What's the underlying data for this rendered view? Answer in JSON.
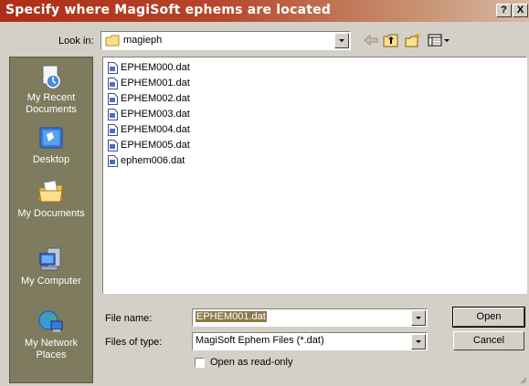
{
  "window": {
    "title": "Specify where MagiSoft ephems are located",
    "help_label": "?",
    "close_label": "X"
  },
  "lookin": {
    "label": "Look in:",
    "value": "magieph"
  },
  "places": [
    {
      "label": "My Recent Documents",
      "icon": "recent-documents-icon"
    },
    {
      "label": "Desktop",
      "icon": "desktop-icon"
    },
    {
      "label": "My Documents",
      "icon": "my-documents-icon"
    },
    {
      "label": "My Computer",
      "icon": "my-computer-icon"
    },
    {
      "label": "My Network Places",
      "icon": "network-places-icon"
    }
  ],
  "files": [
    "EPHEM000.dat",
    "EPHEM001.dat",
    "EPHEM002.dat",
    "EPHEM003.dat",
    "EPHEM004.dat",
    "EPHEM005.dat",
    "ephem006.dat"
  ],
  "filename": {
    "label": "File name:",
    "value": "EPHEM001.dat"
  },
  "filetype": {
    "label": "Files of type:",
    "value": "MagiSoft Ephem Files (*.dat)"
  },
  "readonly": {
    "label": "Open as read-only",
    "checked": false
  },
  "buttons": {
    "open": "Open",
    "cancel": "Cancel"
  },
  "colors": {
    "title_bar": "#ad2e16",
    "places_bar": "#7f7b5e",
    "dialog_bg": "#d4d0c8"
  }
}
